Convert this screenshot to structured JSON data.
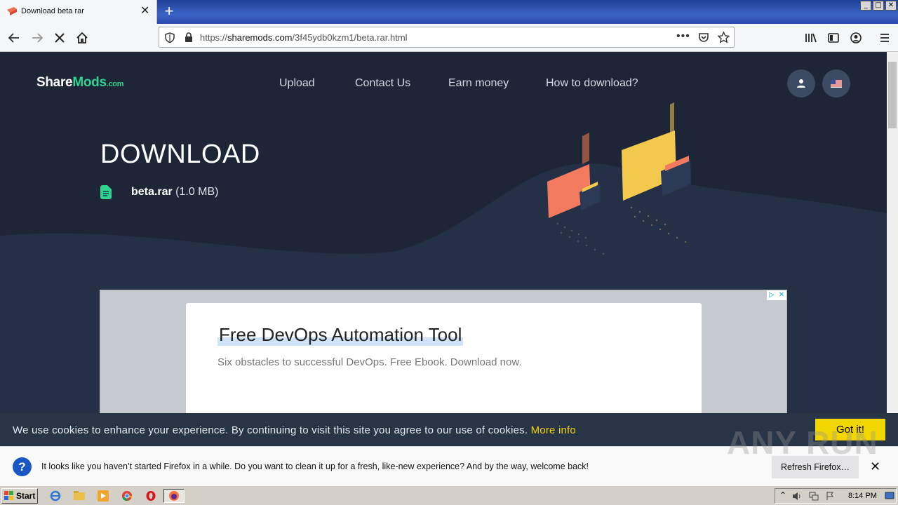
{
  "browser": {
    "tab_title": "Download beta rar",
    "new_tab_label": "+",
    "url_prefix": "https://",
    "url_domain": "sharemods.com",
    "url_path": "/3f45ydb0kzm1/beta.rar.html",
    "window_controls": [
      "_",
      "□",
      "✕"
    ]
  },
  "site": {
    "logo_share": "Share",
    "logo_mods": "Mods",
    "logo_com": ".com",
    "nav": [
      "Upload",
      "Contact Us",
      "Earn money",
      "How to download?"
    ],
    "heading": "DOWNLOAD",
    "file_name": "beta.rar",
    "file_size": "(1.0 MB)"
  },
  "ad": {
    "title": "Free DevOps Automation Tool",
    "subtitle": "Six obstacles to successful DevOps. Free Ebook. Download now.",
    "choices": [
      "▷",
      "✕"
    ]
  },
  "cookie": {
    "message": "We use cookies to enhance your experience. By continuing to visit this site you agree to our use of cookies.",
    "more_info": "More info",
    "button": "Got it!"
  },
  "notification": {
    "icon": "?",
    "text": "It looks like you haven’t started Firefox in a while. Do you want to clean it up for a fresh, like-new experience? And by the way, welcome back!",
    "button": "Refresh Firefox…",
    "close": "✕"
  },
  "watermark": "ANY RUN",
  "taskbar": {
    "start_label": "Start",
    "clock": "8:14 PM"
  },
  "colors": {
    "accent_green": "#2fd490",
    "cookie_yellow": "#f1d600",
    "hero_dark": "#1d2536"
  }
}
